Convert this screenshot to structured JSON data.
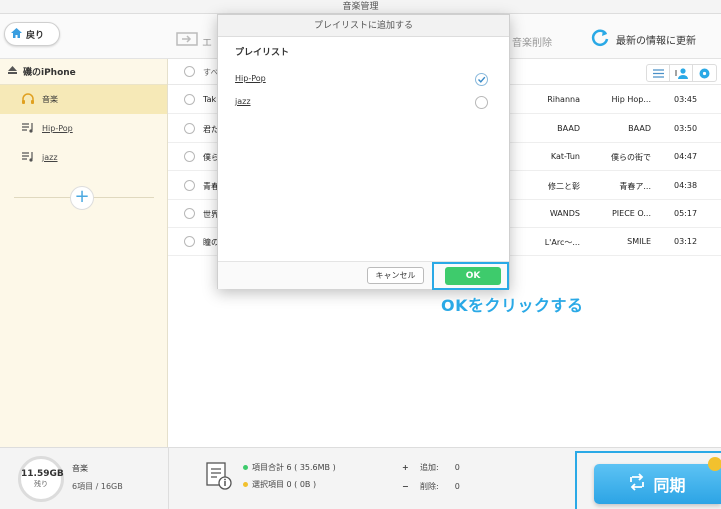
{
  "window": {
    "title": "音楽管理"
  },
  "toolbar": {
    "back_label": "戻り",
    "export_label": "エ",
    "delete_label": "音楽削除",
    "refresh_label": "最新の情報に更新"
  },
  "sidebar": {
    "device_name": "磯のiPhone",
    "items": [
      {
        "label": "音楽",
        "icon": "headphones-icon",
        "active": true
      },
      {
        "label": "Hip-Pop",
        "icon": "playlist-icon",
        "active": false
      },
      {
        "label": "jazz",
        "icon": "playlist-icon",
        "active": false
      }
    ],
    "add_label": "+"
  },
  "list": {
    "select_all_label": "すべ",
    "rows": [
      {
        "title": "Tak",
        "artist": "Rihanna",
        "album": "Hip Hop...",
        "duration": "03:45"
      },
      {
        "title": "君た",
        "artist": "BAAD",
        "album": "BAAD",
        "duration": "03:50"
      },
      {
        "title": "僕ら",
        "artist": "Kat-Tun",
        "album": "僕らの街で",
        "duration": "04:47"
      },
      {
        "title": "青春",
        "artist": "修二と彰",
        "album": "青春ア...",
        "duration": "04:38"
      },
      {
        "title": "世界",
        "artist": "WANDS",
        "album": "PIECE O...",
        "duration": "05:17"
      },
      {
        "title": "瞳の",
        "artist": "L'Arc～...",
        "album": "SMILE",
        "duration": "03:12"
      }
    ]
  },
  "dialog": {
    "title": "プレイリストに追加する",
    "subtitle": "プレイリスト",
    "playlists": [
      {
        "name": "Hip-Pop",
        "checked": true
      },
      {
        "name": "jazz",
        "checked": false
      }
    ],
    "cancel_label": "キャンセル",
    "ok_label": "OK"
  },
  "callout": {
    "text": "OKをクリックする"
  },
  "status": {
    "free_space": "11.59GB",
    "free_label": "残り",
    "category": "音楽",
    "count": "6項目 / 16GB",
    "total_items": "項目合計 6 ( 35.6MB )",
    "selected_items": "選択項目 0 ( 0B )",
    "add_sign": "+",
    "add_label": "追加:",
    "add_count": "0",
    "delete_sign": "−",
    "delete_label": "削除:",
    "delete_count": "0",
    "sync_label": "同期"
  },
  "colors": {
    "accent": "#2aa9e6",
    "ok_green": "#3ecb6c",
    "sidebar_bg": "#fdf8e8",
    "sidebar_active": "#f6e9b7",
    "dot_total": "#3ecb6c",
    "dot_selected": "#f2c12e"
  }
}
